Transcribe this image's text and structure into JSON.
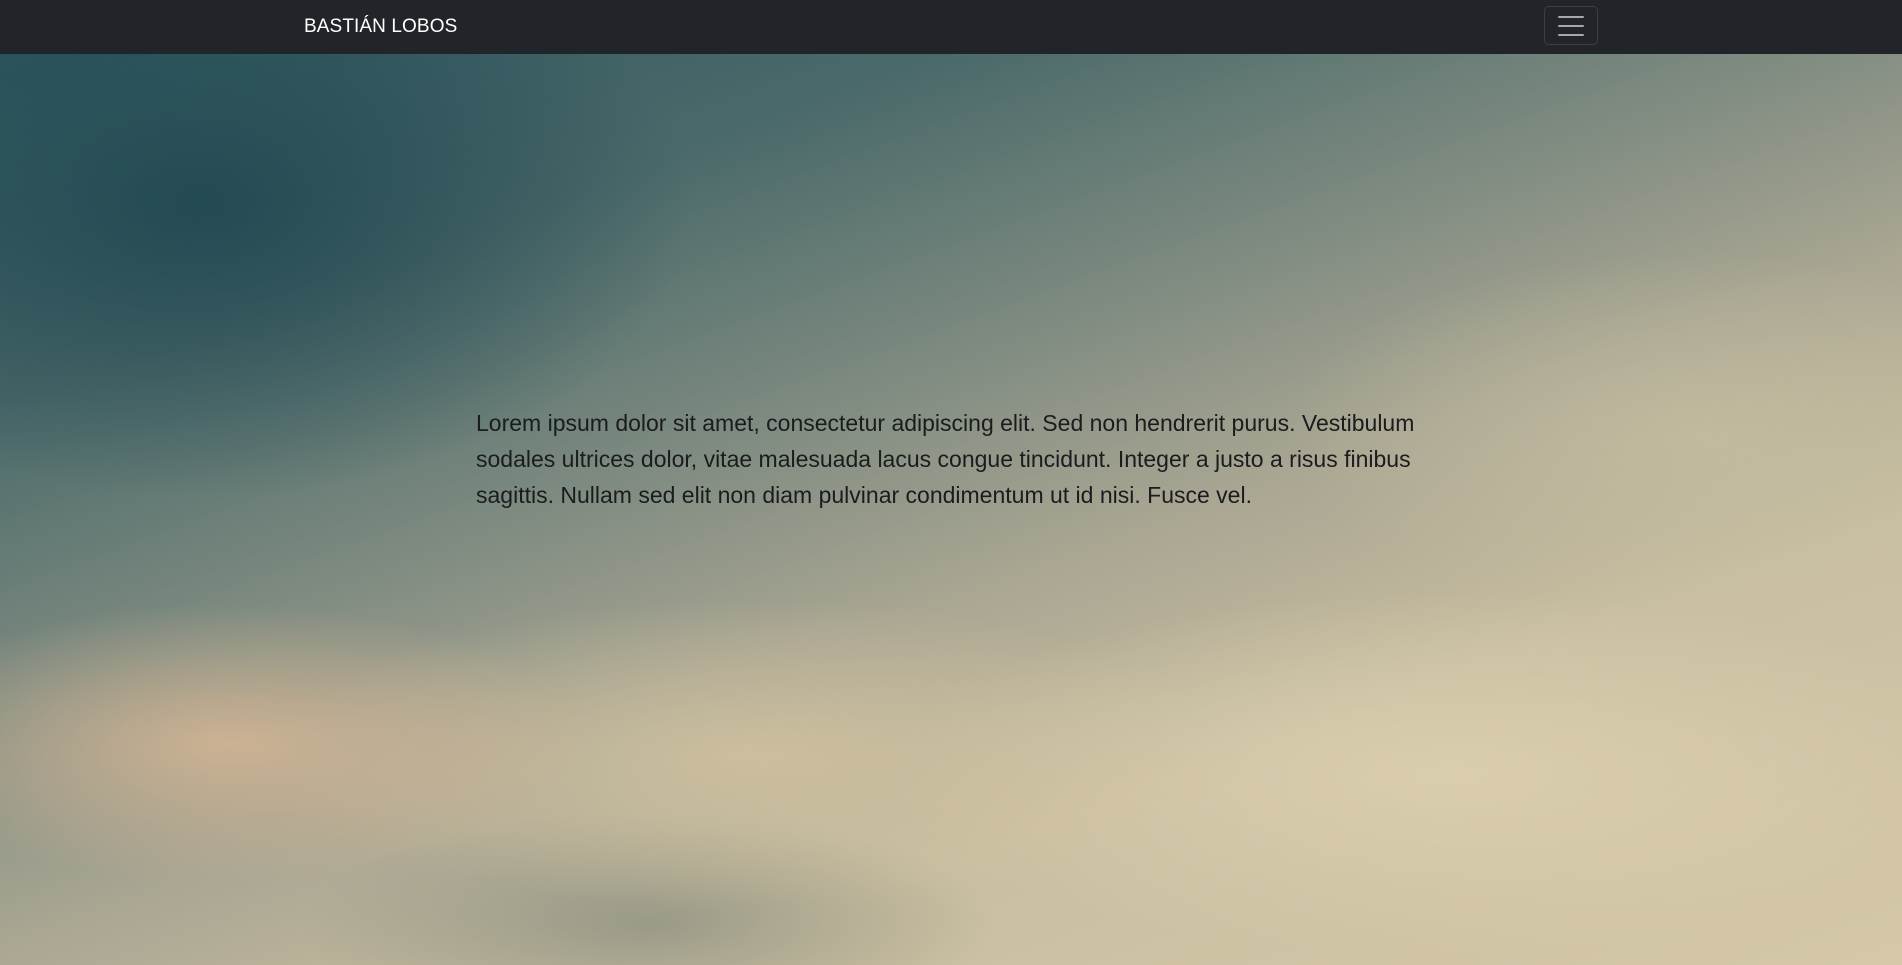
{
  "navbar": {
    "brand": "BASTIÁN LOBOS",
    "toggler_icon": "hamburger-menu-icon"
  },
  "hero": {
    "paragraph": "Lorem ipsum dolor sit amet, consectetur adipiscing elit. Sed non hendrerit purus. Vestibulum sodales ultrices dolor, vitae malesuada lacus congue tincidunt. Integer a justo a risus finibus sagittis. Nullam sed elit non diam pulvinar condimentum ut id nisi. Fusce vel."
  },
  "colors": {
    "navbar_bg": "#212529",
    "brand_text": "#ffffff",
    "body_text": "#1a1c1d"
  }
}
